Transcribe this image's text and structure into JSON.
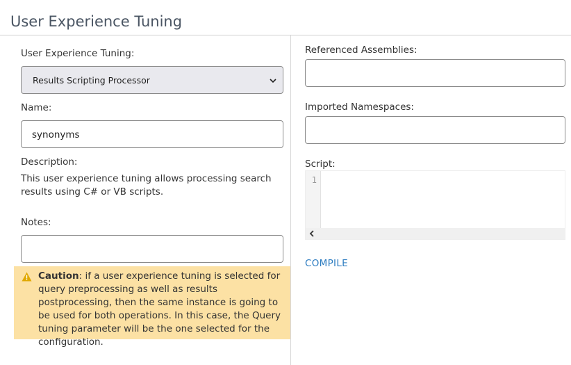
{
  "page": {
    "title": "User Experience Tuning"
  },
  "left": {
    "tuning_label": "User Experience Tuning:",
    "tuning_selected": "Results Scripting Processor",
    "name_label": "Name:",
    "name_value": "synonyms",
    "description_label": "Description:",
    "description_text": "This user experience tuning allows processing search results using C# or VB scripts.",
    "notes_label": "Notes:",
    "notes_value": "",
    "caution": {
      "title": "Caution",
      "text": ": if a user experience tuning is selected for query preprocessing as well as results postprocessing, then the same instance is going to be used for both operations. In this case, the Query tuning parameter will be the one selected for the configuration."
    }
  },
  "right": {
    "assemblies_label": "Referenced Assemblies:",
    "assemblies_value": "",
    "namespaces_label": "Imported Namespaces:",
    "namespaces_value": "",
    "script_label": "Script:",
    "script_line_number": "1",
    "compile_label": "COMPILE"
  },
  "colors": {
    "caution_bg": "#fce1a4",
    "warning_icon": "#e0a800",
    "link": "#2b7bc0",
    "select_bg": "#e9e9ee"
  },
  "icons": [
    "chevron-down-icon",
    "warning-icon",
    "scroll-left-icon"
  ]
}
